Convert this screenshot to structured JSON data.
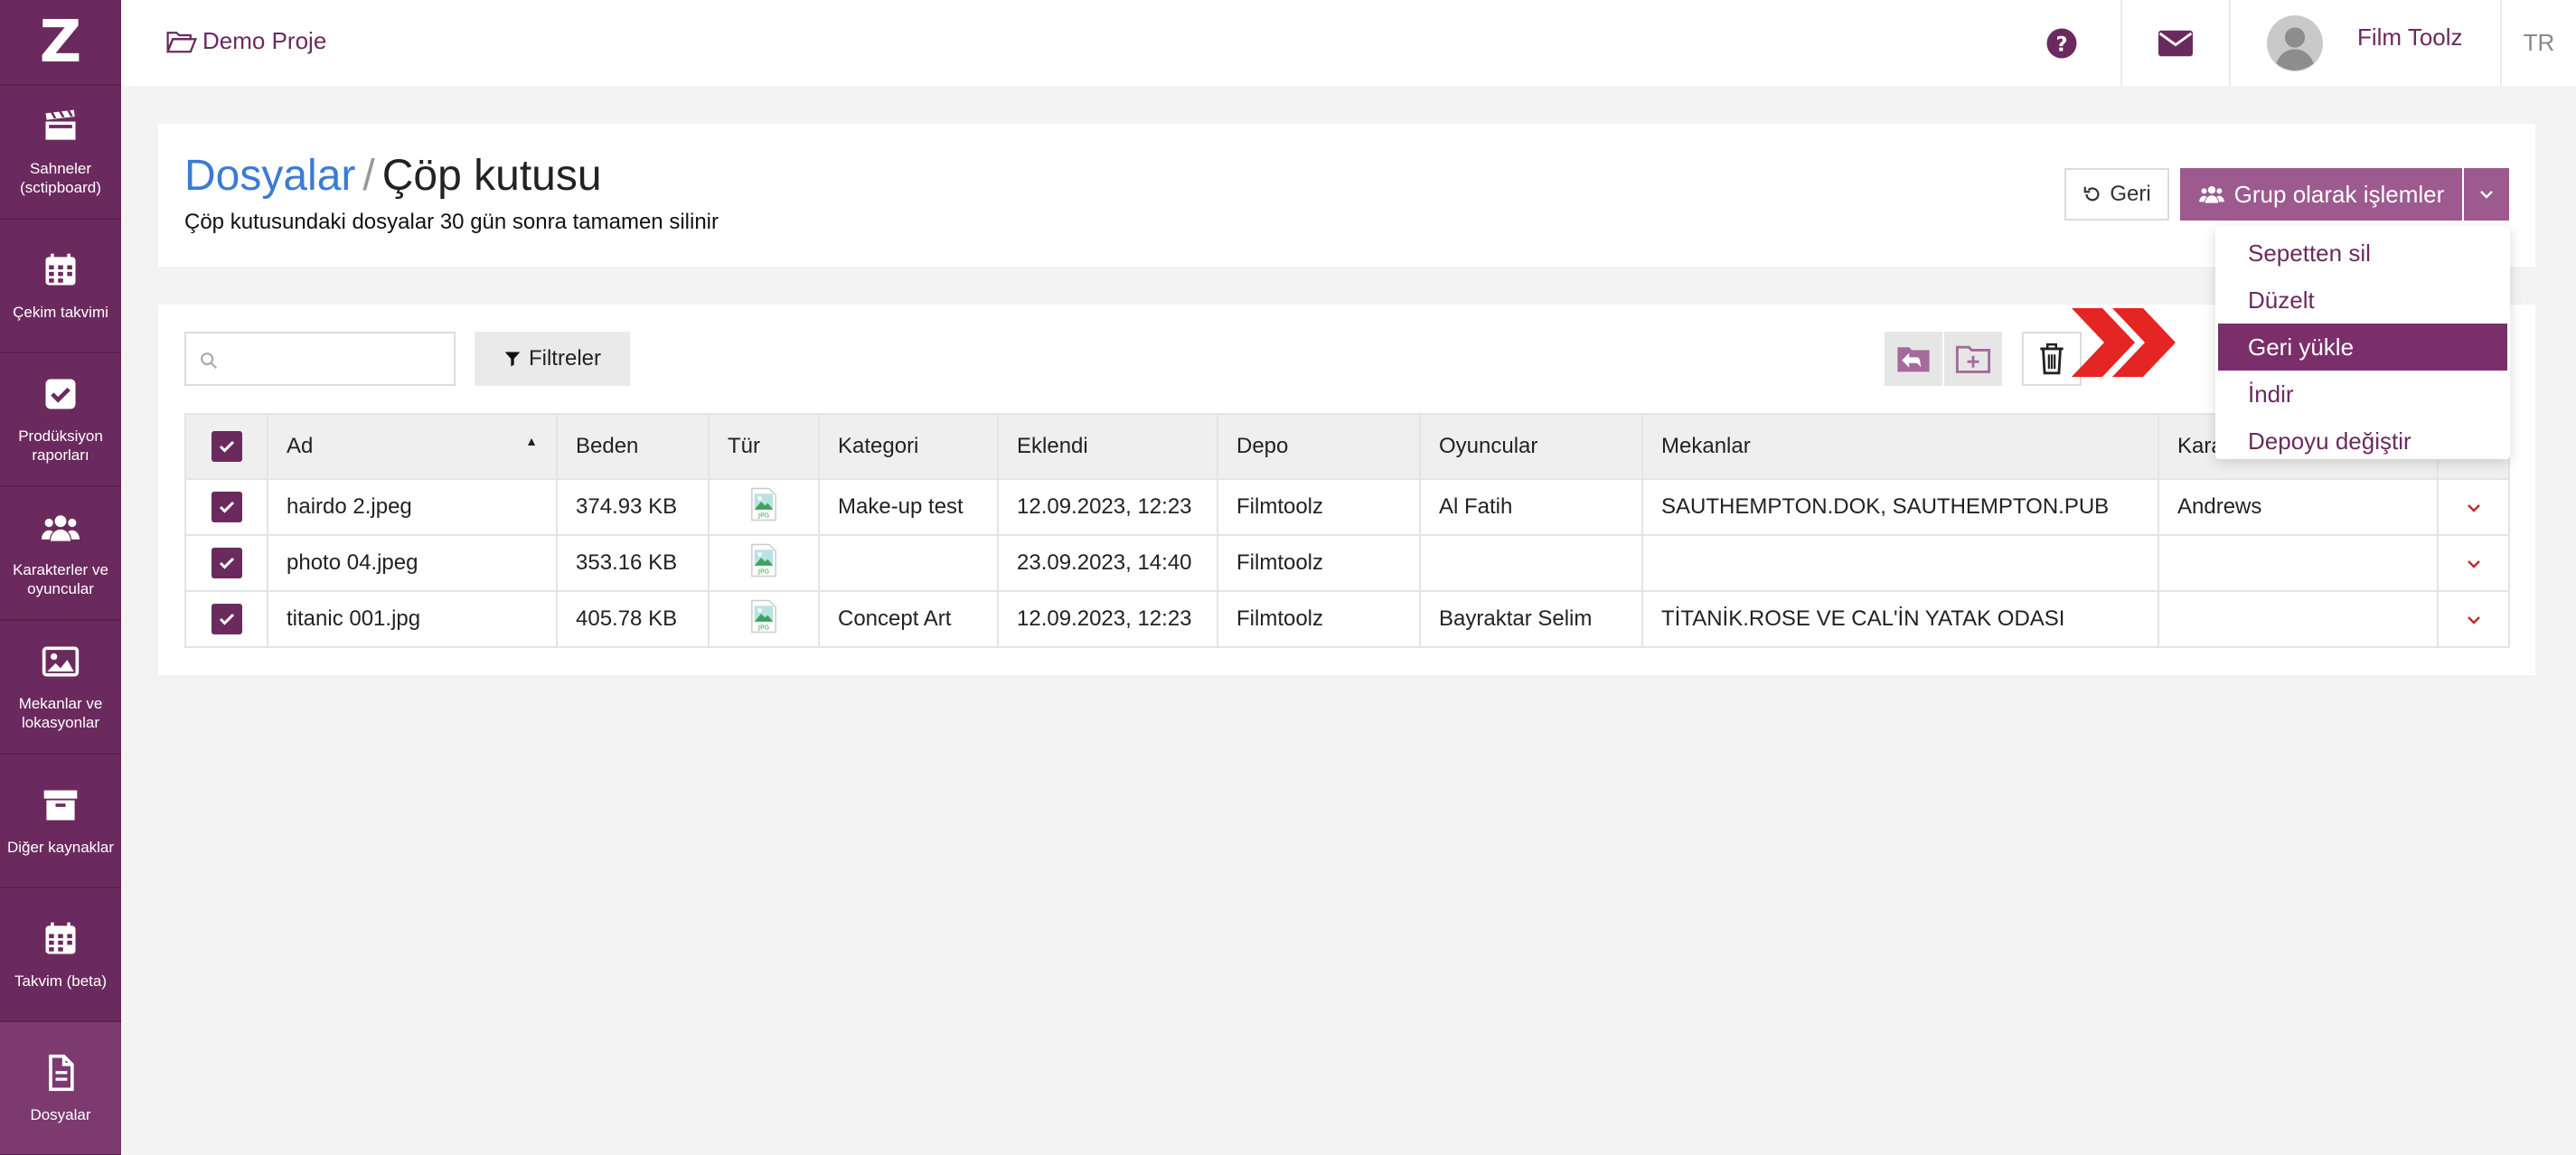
{
  "sidebar": {
    "logo": "Z",
    "items": [
      {
        "label": "Sahneler (sctipboard)",
        "icon": "clapperboard-icon"
      },
      {
        "label": "Çekim takvimi",
        "icon": "calendar-icon"
      },
      {
        "label": "Prodüksiyon raporları",
        "icon": "checkbox-icon"
      },
      {
        "label": "Karakterler ve oyuncular",
        "icon": "users-icon"
      },
      {
        "label": "Mekanlar ve lokasyonlar",
        "icon": "image-icon"
      },
      {
        "label": "Diğer kaynaklar",
        "icon": "archive-icon"
      },
      {
        "label": "Takvim (beta)",
        "icon": "calendar-icon"
      },
      {
        "label": "Dosyalar",
        "icon": "file-icon"
      }
    ]
  },
  "topbar": {
    "project": "Demo Proje",
    "user_name": "Film Toolz",
    "language": "TR"
  },
  "header": {
    "crumb": "Dosyalar",
    "separator": "/",
    "title": "Çöp kutusu",
    "subtitle": "Çöp kutusundaki dosyalar 30 gün sonra tamamen silinir",
    "back_label": "Geri",
    "group_label": "Grup olarak işlemler"
  },
  "dropdown": {
    "items": [
      "Sepetten sil",
      "Düzelt",
      "Geri yükle",
      "İndir",
      "Depoyu değiştir"
    ],
    "active_index": 2
  },
  "toolbar": {
    "search_placeholder": "",
    "filters_label": "Filtreler"
  },
  "table": {
    "columns": [
      "Ad",
      "Beden",
      "Tür",
      "Kategori",
      "Eklendi",
      "Depo",
      "Oyuncular",
      "Mekanlar",
      "Karakterler"
    ],
    "rows": [
      {
        "name": "hairdo 2.jpeg",
        "size": "374.93 KB",
        "type": "JPG",
        "category": "Make-up test",
        "added": "12.09.2023, 12:23",
        "storage": "Filmtoolz",
        "actors": "Al Fatih",
        "locations": "SAUTHEMPTON.DOK, SAUTHEMPTON.PUB",
        "characters": "Andrews"
      },
      {
        "name": "photo 04.jpeg",
        "size": "353.16 KB",
        "type": "JPG",
        "category": "",
        "added": "23.09.2023, 14:40",
        "storage": "Filmtoolz",
        "actors": "",
        "locations": "",
        "characters": ""
      },
      {
        "name": "titanic 001.jpg",
        "size": "405.78 KB",
        "type": "JPG",
        "category": "Concept Art",
        "added": "12.09.2023, 12:23",
        "storage": "Filmtoolz",
        "actors": "Bayraktar Selim",
        "locations": "TİTANİK.ROSE VE CAL'İN YATAK ODASI",
        "characters": ""
      }
    ]
  },
  "colors": {
    "brand": "#6b2a5e",
    "accent_button": "#9c5a8e",
    "link_blue": "#3a7bd5",
    "arrow_red": "#e52424"
  }
}
